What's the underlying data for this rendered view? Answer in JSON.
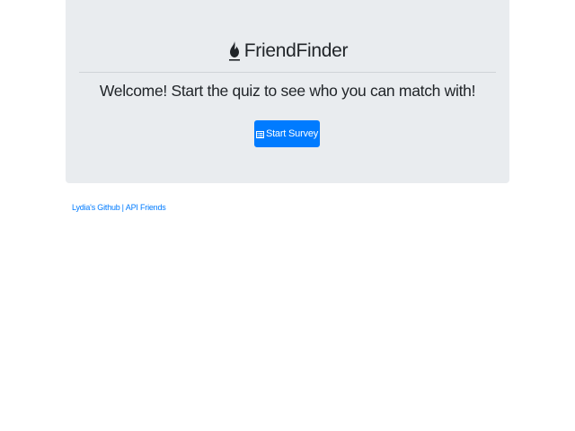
{
  "header": {
    "brand_icon": "fire-icon",
    "brand_title": "FriendFinder",
    "lead": "Welcome! Start the quiz to see who you can match with!",
    "start_button": {
      "icon": "list-alt-icon",
      "label": "Start Survey"
    }
  },
  "footer": {
    "github_link": "Lydia's Github",
    "separator": "|",
    "api_link": "API Friends"
  },
  "colors": {
    "jumbotron_bg": "#e9ecef",
    "primary": "#007bff",
    "text": "#212529"
  }
}
